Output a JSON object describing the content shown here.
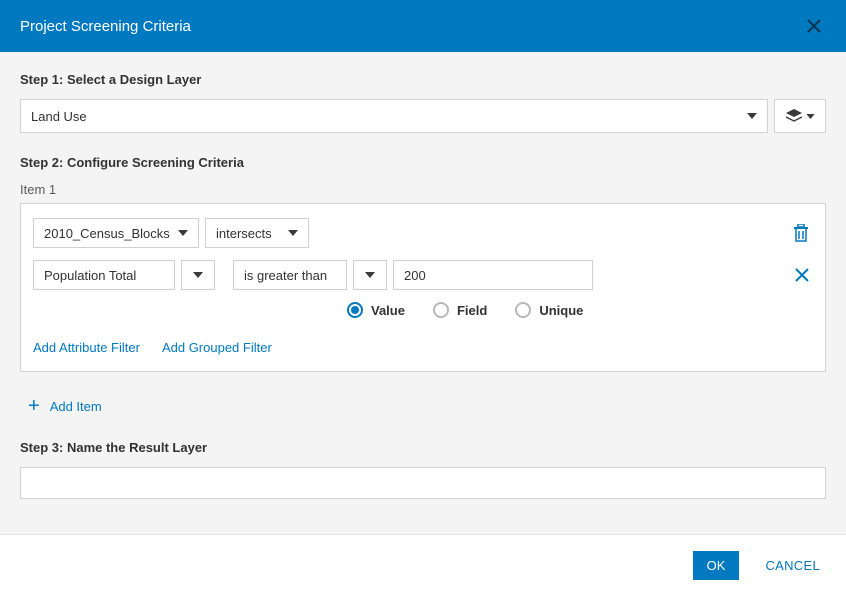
{
  "header": {
    "title": "Project Screening Criteria"
  },
  "step1": {
    "label": "Step 1: Select a Design Layer",
    "design_layer": "Land Use"
  },
  "step2": {
    "label": "Step 2: Configure Screening Criteria",
    "item_label": "Item 1",
    "source_layer": "2010_Census_Blocks",
    "spatial_op": "intersects",
    "attr_field": "Population Total",
    "attr_op": "is greater than",
    "attr_value": "200",
    "radio": {
      "value": "Value",
      "field": "Field",
      "unique": "Unique"
    },
    "add_attribute_filter": "Add Attribute Filter",
    "add_grouped_filter": "Add Grouped Filter",
    "add_item": "Add Item"
  },
  "step3": {
    "label": "Step 3: Name the Result Layer",
    "value": ""
  },
  "footer": {
    "ok": "OK",
    "cancel": "CANCEL"
  },
  "colors": {
    "primary": "#0079c1",
    "border": "#d1d1d1",
    "panel": "#f4f4f4"
  }
}
